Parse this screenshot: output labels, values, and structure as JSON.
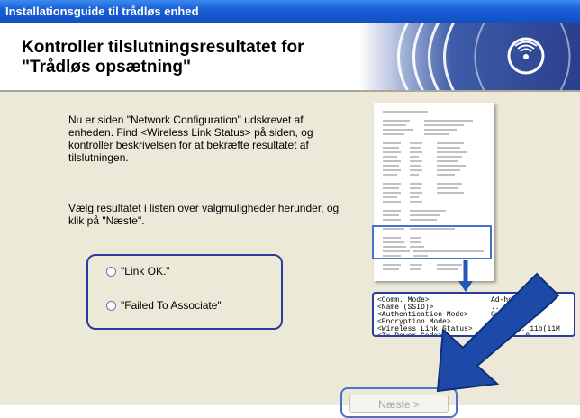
{
  "window": {
    "title": "Installationsguide til trådløs enhed"
  },
  "header": {
    "title_line1": "Kontroller tilslutningsresultatet for",
    "title_line2": "\"Trådløs opsætning\""
  },
  "content": {
    "paragraph1": "Nu er siden \"Network Configuration\" udskrevet af enheden. Find <Wireless Link Status> på siden, og kontroller beskrivelsen for at bekræfte resultatet af tilslutningen.",
    "paragraph2": "Vælg resultatet i listen over valgmuligheder herunder, og klik på \"Næste\"."
  },
  "options": [
    {
      "label": "\"Link OK.\"",
      "selected": false
    },
    {
      "label": "\"Failed To Associate\"",
      "selected": false
    }
  ],
  "callout": {
    "left_lines": "<Comm. Mode>\n<Name (SSID)>\n<Authentication Mode>\n<Encryption Mode>\n<Wireless Link Status>\n<Tx Power Code>",
    "right_lines": "Ad-hoc\n...\nOpen System\nNone\nLink OK. 11b(11M\nJPN, 1, 0"
  },
  "buttons": {
    "next_label": "Næste >"
  },
  "colors": {
    "titlebar": "#1a5fd6",
    "accent_blue": "#2a3d9c",
    "arrow_blue": "#2456b5"
  }
}
